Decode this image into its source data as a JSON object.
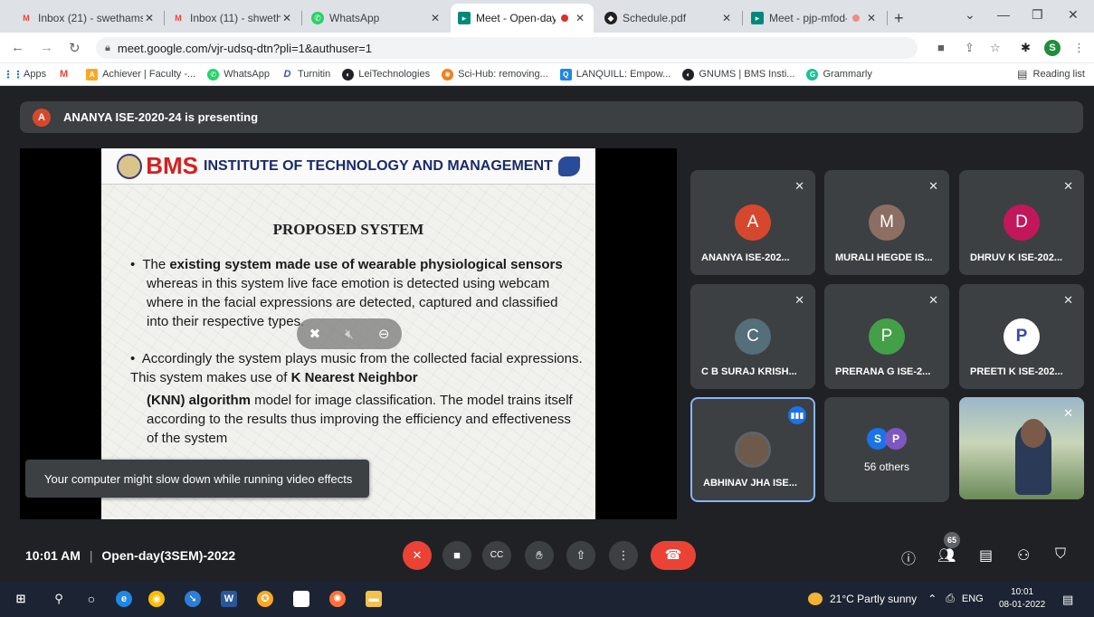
{
  "browser": {
    "tabs": [
      {
        "title": "Inbox (21) - swethams",
        "favicon": "gmail-icon",
        "active": false
      },
      {
        "title": "Inbox (11) - shwethan",
        "favicon": "gmail-icon",
        "active": false
      },
      {
        "title": "WhatsApp",
        "favicon": "whatsapp-icon",
        "active": false
      },
      {
        "title": "Meet - Open-day(",
        "favicon": "meet-icon",
        "active": true,
        "recording": true
      },
      {
        "title": "Schedule.pdf",
        "favicon": "pdf-icon",
        "active": false
      },
      {
        "title": "Meet - pjp-mfod-",
        "favicon": "meet-icon",
        "active": false,
        "recording": true
      }
    ],
    "url": "meet.google.com/vjr-udsq-dtn?pli=1&authuser=1",
    "profile_initial": "S",
    "bookmarks": [
      {
        "label": "Apps",
        "icon": "apps-grid-icon"
      },
      {
        "label": "",
        "icon": "gmail-icon"
      },
      {
        "label": "Achiever | Faculty -...",
        "icon": "achiever-icon"
      },
      {
        "label": "WhatsApp",
        "icon": "whatsapp-icon"
      },
      {
        "label": "Turnitin",
        "icon": "turnitin-icon"
      },
      {
        "label": "LeiTechnologies",
        "icon": "globe-icon"
      },
      {
        "label": "Sci-Hub: removing...",
        "icon": "scihub-icon"
      },
      {
        "label": "LANQUILL: Empow...",
        "icon": "lanquill-icon"
      },
      {
        "label": "GNUMS | BMS Insti...",
        "icon": "globe-icon"
      },
      {
        "label": "Grammarly",
        "icon": "grammarly-icon"
      }
    ],
    "reading_list": "Reading list"
  },
  "meet": {
    "presenting_initial": "A",
    "presenting_text": "ANANYA ISE-2020-24 is presenting",
    "slide": {
      "institute_short": "BMS",
      "institute_long": "INSTITUTE OF TECHNOLOGY AND MANAGEMENT",
      "title": "PROPOSED SYSTEM",
      "bullet1_pre": "The ",
      "bullet1_bold": "existing system made use of wearable physiological sensors",
      "bullet1_rest": "whereas in this system live face emotion is detected using webcam where in the facial expressions are detected, captured and classified into their respective types.",
      "bullet2_pre": " Accordingly the system plays music from the collected facial expressions. This system makes use of ",
      "bullet2_bold1": "K Nearest Neighbor",
      "bullet2_bold2": "(KNN) algorithm",
      "bullet2_rest": " model for image classification. The model trains itself according to the results thus improving the efficiency and effectiveness of the system"
    },
    "toast": "Your computer might slow down while running video effects",
    "participants": [
      {
        "initial": "A",
        "name": "ANANYA ISE-202...",
        "color": "#d6482d"
      },
      {
        "initial": "M",
        "name": "MURALI HEGDE IS...",
        "color": "#8d6e63"
      },
      {
        "initial": "D",
        "name": "DHRUV K ISE-202...",
        "color": "#c2185b"
      },
      {
        "initial": "C",
        "name": "C B SURAJ KRISH...",
        "color": "#546e7a"
      },
      {
        "initial": "P",
        "name": "PRERANA G ISE-2...",
        "color": "#43a047"
      },
      {
        "initial": "P",
        "name": "PREETI K ISE-202...",
        "color": "#ffffff"
      },
      {
        "initial": "",
        "name": "ABHINAV JHA ISE...",
        "color": "#6d5a4a"
      }
    ],
    "others": {
      "label": "56 others",
      "initials": [
        "S",
        "P"
      ]
    },
    "bottom": {
      "time": "10:01 AM",
      "meeting_name": "Open-day(3SEM)-2022",
      "people_count": "65"
    }
  },
  "taskbar": {
    "weather": "21°C  Partly sunny",
    "lang": "ENG",
    "time": "10:01",
    "date": "08-01-2022"
  }
}
